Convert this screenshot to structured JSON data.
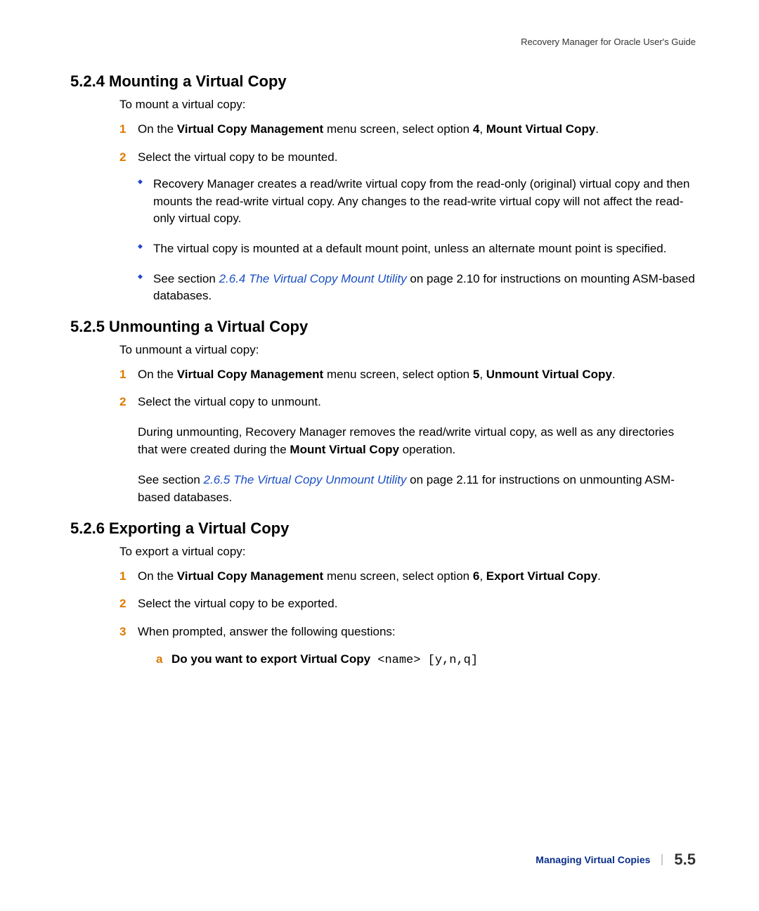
{
  "running_head": "Recovery Manager for Oracle User's Guide",
  "sections": {
    "s524": {
      "heading": "5.2.4 Mounting a Virtual Copy",
      "intro": "To mount a virtual copy:",
      "step1_pre": "On the ",
      "step1_b1": "Virtual Copy Management",
      "step1_mid": " menu screen, select option ",
      "step1_b2": "4",
      "step1_sep": ", ",
      "step1_b3": "Mount Virtual Copy",
      "step1_end": ".",
      "step2": "Select the virtual copy to be mounted.",
      "bullet1": "Recovery Manager creates a read/write virtual copy from the read-only (original) virtual copy and then mounts the read-write virtual copy. Any changes to the read-write virtual copy will not affect the read-only virtual copy.",
      "bullet2": "The virtual copy is mounted at a default mount point, unless an alternate mount point is specified.",
      "bullet3_pre": "See section ",
      "bullet3_link": "2.6.4 The Virtual Copy Mount Utility",
      "bullet3_post": " on page 2.10 for instructions on mounting ASM-based databases."
    },
    "s525": {
      "heading": "5.2.5 Unmounting a Virtual Copy",
      "intro": "To unmount a virtual copy:",
      "step1_pre": "On the ",
      "step1_b1": "Virtual Copy Management",
      "step1_mid": " menu screen, select option ",
      "step1_b2": "5",
      "step1_sep": ", ",
      "step1_b3": "Unmount Virtual Copy",
      "step1_end": ".",
      "step2": "Select the virtual copy to unmount.",
      "para1_pre": "During unmounting, Recovery Manager removes the read/write virtual copy, as well as any directories that were created during the ",
      "para1_b": "Mount Virtual Copy",
      "para1_post": " operation.",
      "para2_pre": "See section ",
      "para2_link": "2.6.5 The Virtual Copy Unmount Utility",
      "para2_post": " on page 2.11 for instructions on unmounting ASM-based databases."
    },
    "s526": {
      "heading": "5.2.6 Exporting a Virtual Copy",
      "intro": "To export a virtual copy:",
      "step1_pre": "On the ",
      "step1_b1": "Virtual Copy Management",
      "step1_mid": " menu screen, select option ",
      "step1_b2": "6",
      "step1_sep": ", ",
      "step1_b3": "Export Virtual Copy",
      "step1_end": ".",
      "step2": "Select the virtual copy to be exported.",
      "step3": "When prompted, answer the following questions:",
      "sub_a_bold": "Do you want to export Virtual Copy",
      "sub_a_mono": " <name> [y,n,q]"
    }
  },
  "nums": {
    "n1": "1",
    "n2": "2",
    "n3": "3",
    "a": "a"
  },
  "footer": {
    "chapter": "Managing Virtual Copies",
    "page": "5.5"
  }
}
